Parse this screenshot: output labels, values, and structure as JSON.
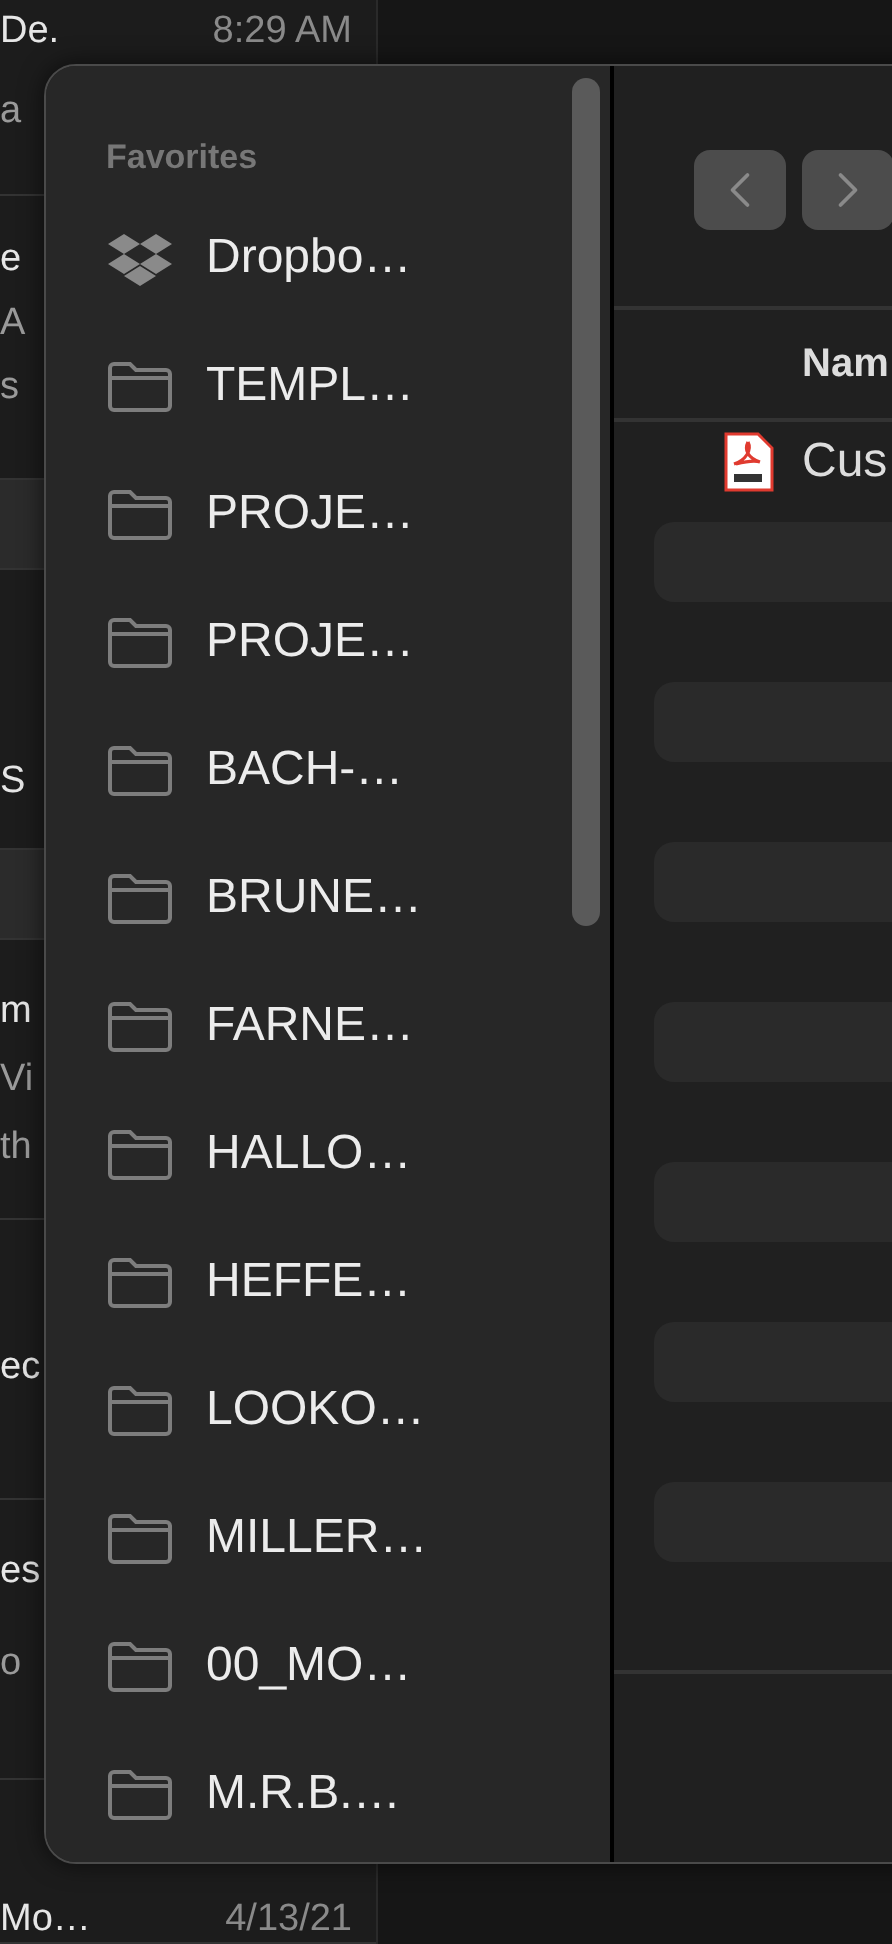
{
  "mail_list": [
    {
      "kind": "message",
      "lines": [
        "De.",
        "a"
      ],
      "time": "8:29 AM"
    },
    {
      "kind": "message",
      "lines": [
        "e",
        "A",
        "s"
      ]
    },
    {
      "kind": "header"
    },
    {
      "kind": "message",
      "lines": [
        "S"
      ]
    },
    {
      "kind": "header"
    },
    {
      "kind": "message",
      "lines": [
        "m",
        "Vi",
        "th"
      ]
    },
    {
      "kind": "message",
      "lines": [
        "ec"
      ]
    },
    {
      "kind": "message",
      "lines": [
        "es",
        "o"
      ]
    },
    {
      "kind": "message",
      "lines": [
        "Mo…"
      ],
      "time": "4/13/21"
    }
  ],
  "dialog": {
    "sidebar": {
      "section": "Favorites",
      "items": [
        {
          "label": "Dropbo…",
          "kind": "dropbox"
        },
        {
          "label": "TEMPL…",
          "kind": "folder"
        },
        {
          "label": "PROJE…",
          "kind": "folder"
        },
        {
          "label": "PROJE…",
          "kind": "folder"
        },
        {
          "label": "BACH-…",
          "kind": "folder"
        },
        {
          "label": "BRUNE…",
          "kind": "folder"
        },
        {
          "label": "FARNE…",
          "kind": "folder"
        },
        {
          "label": "HALLO…",
          "kind": "folder"
        },
        {
          "label": "HEFFE…",
          "kind": "folder"
        },
        {
          "label": "LOOKO…",
          "kind": "folder"
        },
        {
          "label": "MILLER…",
          "kind": "folder"
        },
        {
          "label": "00_MO…",
          "kind": "folder"
        },
        {
          "label": "M.R.B.…",
          "kind": "folder"
        }
      ]
    },
    "column_header": "Nam",
    "files": [
      {
        "name": "Cus",
        "kind": "pdf"
      }
    ]
  }
}
